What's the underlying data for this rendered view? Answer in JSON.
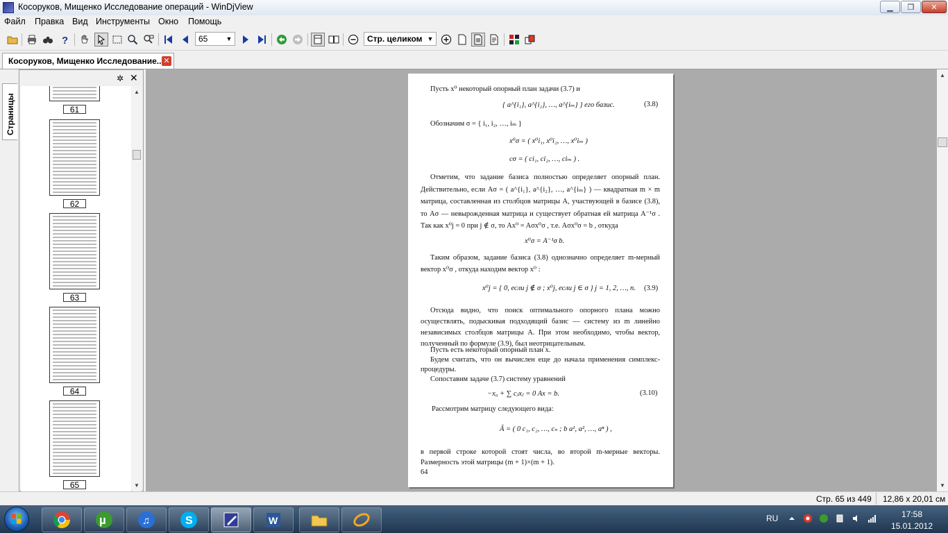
{
  "window": {
    "title": "Косоруков, Мищенко Исследование операций - WinDjView"
  },
  "menu": [
    "Файл",
    "Правка",
    "Вид",
    "Инструменты",
    "Окно",
    "Помощь"
  ],
  "toolbar": {
    "page_number": "65",
    "zoom": "Стр. целиком"
  },
  "tab": {
    "label": "Косоруков, Мищенко Исследование..."
  },
  "pages_panel": {
    "label": "Страницы",
    "thumbnails": [
      "61",
      "62",
      "63",
      "64",
      "65"
    ]
  },
  "page": {
    "l1": "Пусть x⁰ некоторый опорный план задачи (3.7) и",
    "eq38": "{ a^{i₁}, a^{i₂}, …, a^{iₘ} } его базис.",
    "eq38_no": "(3.8)",
    "l2": "Обозначим σ = { i₁, i₂, …, iₘ }",
    "eq_x": "x⁰σ = ( x⁰i₁, x⁰i₂, …, x⁰iₘ )",
    "eq_c": "cσ = ( ci₁, ci₂, …, ciₘ ) .",
    "p1": "Отметим, что задание базиса полностью определяет опорный план. Действительно, если Aσ = ( a^{i₁}, a^{i₂}, …, a^{iₘ} ) — квадратная m × m матрица, составленная из столбцов матрицы A, участвующей в базисе (3.8), то Aσ — невырожденная матрица и существует обратная ей матрица A⁻¹σ . Так как x⁰j = 0  при j ∉ σ, то Ax⁰ = Aσx⁰σ , т.е. Aσx⁰σ = b , откуда",
    "eq_inv": "x⁰σ = A⁻¹σ b.",
    "p2": "Таким образом, задание базиса (3.8) однозначно определяет m-мерный вектор x⁰σ , откуда находим вектор x⁰ :",
    "eq39": "x⁰j = { 0,  если  j ∉ σ ;  x⁰j,  если  j ∈ σ }     j = 1, 2, …, n.",
    "eq39_no": "(3.9)",
    "p3": "Отсюда видно, что поиск оптимального опорного плана можно осуществлять, подыскивая подходящий базис — систему из m линейно независимых столбцов матрицы A. При этом необходимо, чтобы вектор, полученный по формуле (3.9), был неотрицательным.",
    "l3": "Пусть есть некоторый опорный план x.",
    "p4": "Будем считать, что он вычислен еще до начала применения симплекс-процедуры.",
    "l4": "Сопоставим задаче (3.7) систему уравнений",
    "eq310": "−x₀ + ∑ cⱼxⱼ = 0     Ax = b.",
    "eq310_no": "(3.10)",
    "l5": "Рассмотрим матрицу следующего вида:",
    "eq_mat": "Ã = ( 0  c₁,  c₂, …, cₙ ;  b  a¹,  a², …, aⁿ ) ,",
    "p5": "в первой строке которой стоят числа, во второй m-мерные векторы. Размерность этой матрицы (m + 1)×(m + 1).",
    "page_no": "64"
  },
  "status": {
    "pages": "Стр. 65 из 449",
    "size": "12,86 x 20,01 см"
  },
  "taskbar": {
    "lang": "RU",
    "time": "17:58",
    "date": "15.01.2012",
    "apps": [
      "chrome-icon",
      "utorrent-icon",
      "itunes-icon",
      "skype-icon",
      "windjview-icon",
      "word-icon",
      "explorer-icon",
      "messenger-icon"
    ]
  },
  "colors": {
    "doc_bg": "#ababab",
    "taskbar": "#2a4460",
    "tab_close": "#d0402b"
  }
}
